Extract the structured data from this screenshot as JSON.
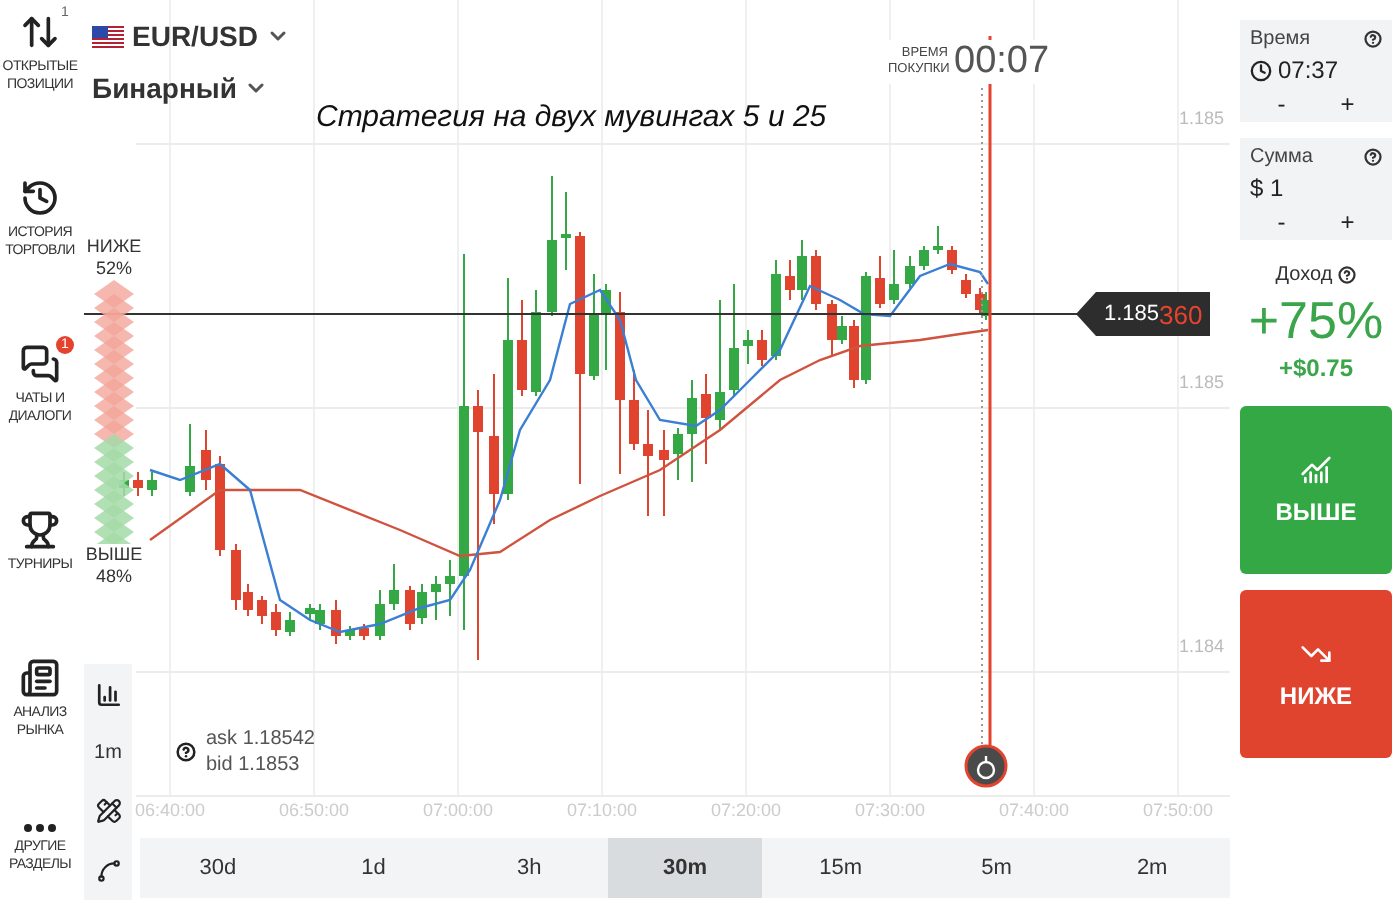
{
  "sidebar": {
    "items": [
      {
        "label": "ОТКРЫТЫЕ ПОЗИЦИИ",
        "badge": {
          "text": "1",
          "alert": false
        }
      },
      {
        "label": "ИСТОРИЯ ТОРГОВЛИ"
      },
      {
        "label": "ЧАТЫ И ДИАЛОГИ",
        "badge": {
          "text": "1",
          "alert": true
        }
      },
      {
        "label": "ТУРНИРЫ"
      },
      {
        "label": "АНАЛИЗ РЫНКА"
      },
      {
        "label": "ДРУГИЕ РАЗДЕЛЫ"
      }
    ]
  },
  "asset": {
    "pair": "EUR/USD",
    "mode": "Бинарный"
  },
  "caption": "Стратегия на двух мувингах 5 и 25",
  "timer": {
    "label": "ВРЕМЯ ПОКУПКИ",
    "value": "00:07"
  },
  "sentiment": {
    "down": {
      "label": "НИЖЕ",
      "value": "52%"
    },
    "up": {
      "label": "ВЫШЕ",
      "value": "48%"
    }
  },
  "chart": {
    "y_labels": [
      "1.185",
      "1.185",
      "1.184"
    ],
    "x_labels": [
      "06:40:00",
      "06:50:00",
      "07:00:00",
      "07:10:00",
      "07:20:00",
      "07:30:00",
      "07:40:00",
      "07:50:00"
    ],
    "price_tag": {
      "main": "1.185",
      "accent": "360"
    },
    "quote": {
      "ask": "ask 1.18542",
      "bid": "bid 1.1853"
    }
  },
  "interval": "1m",
  "timeframes": [
    {
      "label": "30d",
      "selected": false
    },
    {
      "label": "1d",
      "selected": false
    },
    {
      "label": "3h",
      "selected": false
    },
    {
      "label": "30m",
      "selected": true
    },
    {
      "label": "15m",
      "selected": false
    },
    {
      "label": "5m",
      "selected": false
    },
    {
      "label": "2m",
      "selected": false
    }
  ],
  "panel": {
    "time": {
      "label": "Время",
      "value": "07:37",
      "minus": "-",
      "plus": "+"
    },
    "amount": {
      "label": "Сумма",
      "value": "$ 1",
      "minus": "-",
      "plus": "+"
    },
    "profit": {
      "label": "Доход",
      "percent": "+75%",
      "amount": "+$0.75"
    },
    "buttons": [
      {
        "label": "ВЫШЕ",
        "kind": "up"
      },
      {
        "label": "НИЖЕ",
        "kind": "down"
      }
    ]
  }
}
